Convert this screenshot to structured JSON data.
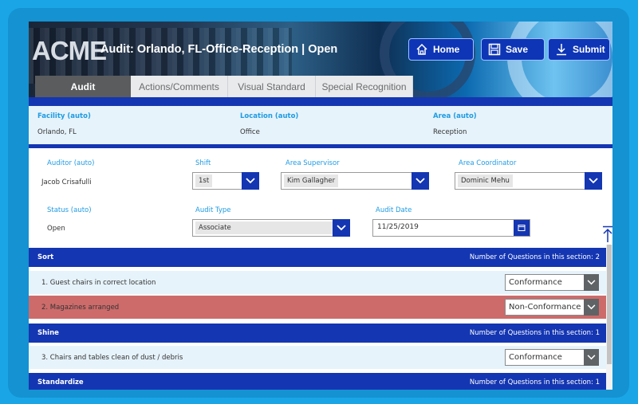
{
  "header": {
    "logo": "ACME",
    "title": "Audit: Orlando, FL-Office-Reception | Open",
    "buttons": {
      "home": "Home",
      "save": "Save",
      "submit": "Submit"
    }
  },
  "tabs": [
    "Audit",
    "Actions/Comments",
    "Visual Standard",
    "Special Recognition"
  ],
  "info": {
    "facility": {
      "label": "Facility (auto)",
      "value": "Orlando, FL"
    },
    "location": {
      "label": "Location (auto)",
      "value": "Office"
    },
    "area": {
      "label": "Area (auto)",
      "value": "Reception"
    }
  },
  "form": {
    "auditor": {
      "label": "Auditor (auto)",
      "value": "Jacob Crisafulli"
    },
    "shift": {
      "label": "Shift",
      "value": "1st"
    },
    "area_supervisor": {
      "label": "Area Supervisor",
      "value": "Kim Gallagher"
    },
    "area_coordinator": {
      "label": "Area Coordinator",
      "value": "Dominic Mehu"
    },
    "status": {
      "label": "Status (auto)",
      "value": "Open"
    },
    "audit_type": {
      "label": "Audit Type",
      "value": "Associate"
    },
    "audit_date": {
      "label": "Audit Date",
      "value": "11/25/2019"
    }
  },
  "sections": [
    {
      "name": "Sort",
      "count": "Number of Questions in this section: 2"
    },
    {
      "name": "Shine",
      "count": "Number of Questions in this section: 1"
    },
    {
      "name": "Standardize",
      "count": "Number of Questions in this section: 1"
    }
  ],
  "questions": [
    {
      "text": "1.  Guest chairs in correct location",
      "answer": "Conformance"
    },
    {
      "text": "2.  Magazines arranged",
      "answer": "Non-Conformance"
    },
    {
      "text": "3.  Chairs and tables clean of dust / debris",
      "answer": "Conformance"
    }
  ],
  "colors": {
    "accent": "#1436b2",
    "info_label": "#1f9be3",
    "non_conformance_row": "#cd6b6b",
    "row_bg": "#e6f3fb"
  }
}
